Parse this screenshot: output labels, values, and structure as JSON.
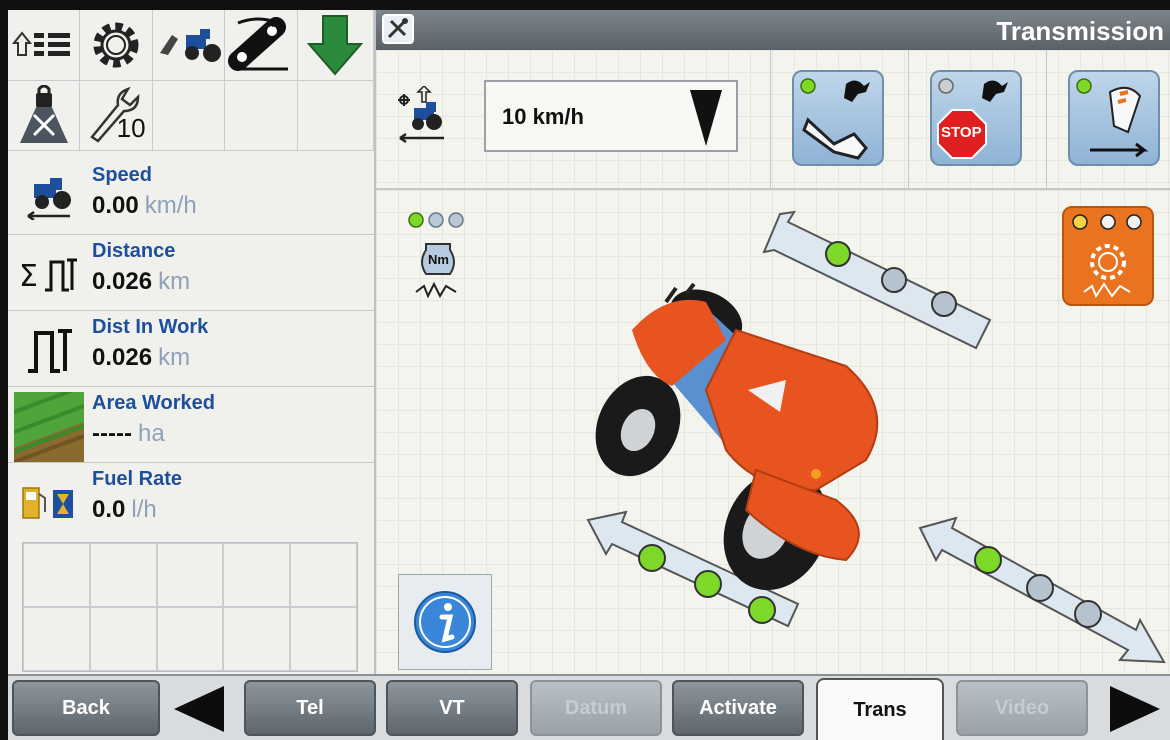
{
  "header": {
    "title": "Transmission"
  },
  "metrics": [
    {
      "label": "Speed",
      "value": "0.00",
      "unit": "km/h"
    },
    {
      "label": "Distance",
      "value": "0.026",
      "unit": "km"
    },
    {
      "label": "Dist In Work",
      "value": "0.026",
      "unit": "km"
    },
    {
      "label": "Area Worked",
      "value": "-----",
      "unit": "ha"
    },
    {
      "label": "Fuel Rate",
      "value": "0.0",
      "unit": "l/h"
    }
  ],
  "toolbar": {
    "service_badge": "10"
  },
  "speed_setting": {
    "value": "10 km/h"
  },
  "buttons": {
    "stop_label": "STOP",
    "nm_label": "Nm"
  },
  "bottom": {
    "back": "Back",
    "tel": "Tel",
    "vt": "VT",
    "datum": "Datum",
    "activate": "Activate",
    "trans": "Trans",
    "video": "Video"
  },
  "colors": {
    "accent_blue": "#1e4f9c",
    "led_green": "#7dd82a",
    "tractor_orange": "#e8541f",
    "orange_button": "#e9731f"
  }
}
